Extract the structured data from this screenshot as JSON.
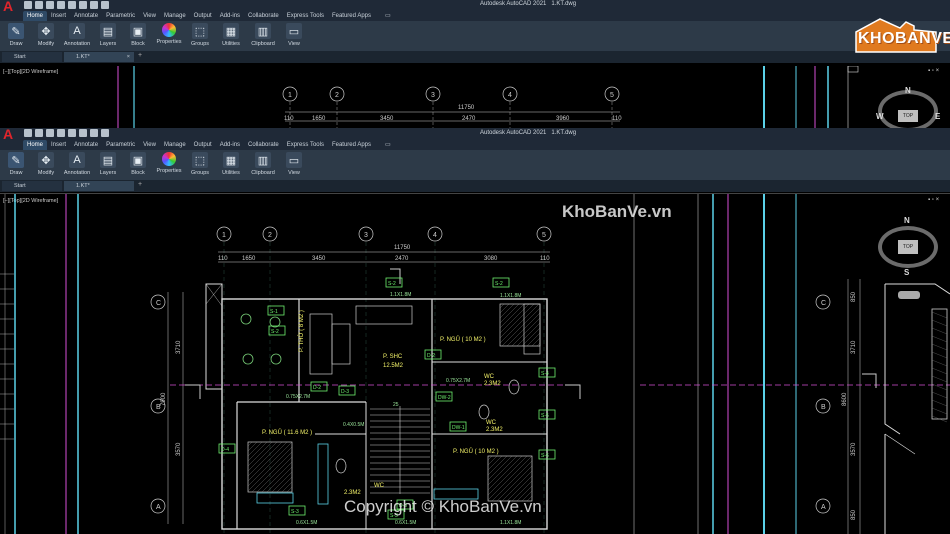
{
  "app": {
    "title": "Autodesk AutoCAD 2021",
    "file": "1.KT.dwg",
    "menu_tabs": [
      "Home",
      "Insert",
      "Annotate",
      "Parametric",
      "View",
      "Manage",
      "Output",
      "Add-ins",
      "Collaborate",
      "Express Tools",
      "Featured Apps"
    ],
    "ribbon_panels": [
      {
        "label": "Draw",
        "icon": "pencil-icon"
      },
      {
        "label": "Modify",
        "icon": "move-icon"
      },
      {
        "label": "Annotation",
        "icon": "text-icon"
      },
      {
        "label": "Layers",
        "icon": "layers-icon"
      },
      {
        "label": "Block",
        "icon": "block-icon"
      },
      {
        "label": "Properties",
        "icon": "color-wheel-icon"
      },
      {
        "label": "Groups",
        "icon": "groups-icon"
      },
      {
        "label": "Utilities",
        "icon": "calculator-icon"
      },
      {
        "label": "Clipboard",
        "icon": "clipboard-icon"
      },
      {
        "label": "View",
        "icon": "view-icon"
      }
    ],
    "doc_tabs": {
      "start": "Start",
      "active": "1.KT*"
    },
    "view_label": "[−][Top][2D Wireframe]",
    "close": "×",
    "plus": "+"
  },
  "navcube": {
    "n": "N",
    "s": "S",
    "e": "E",
    "w": "W",
    "top": "TOP"
  },
  "watermarks": {
    "logo": "KHOBANVE",
    "site": "KhoBanVe.vn",
    "copyright": "Copyright © KhoBanVe.vn"
  },
  "drawing": {
    "grid_numbers": [
      "1",
      "2",
      "3",
      "4",
      "5"
    ],
    "grid_letters": [
      "C",
      "B",
      "A"
    ],
    "overall_dim": "11750",
    "dims": [
      "110",
      "1650",
      "3450",
      "2470",
      "3960",
      "110"
    ],
    "dims2": [
      "110",
      "1650",
      "3450",
      "2470",
      "3080",
      "110"
    ],
    "rooms": [
      {
        "name": "P. NGỦ ( 10 M2 )"
      },
      {
        "name": "P. SHC"
      },
      {
        "name": "12.5M2"
      },
      {
        "name": "P. THỜ ( 8 M2 )"
      },
      {
        "name": "P. NGỦ ( 11.6 M2 )"
      },
      {
        "name": "P. NGỦ ( 10 M2 )"
      },
      {
        "name": "WC"
      },
      {
        "name": "2.3M2"
      },
      {
        "name": "WC"
      },
      {
        "name": "2.3M2"
      },
      {
        "name": "WC"
      },
      {
        "name": "2.3M2"
      }
    ],
    "left_dims": [
      "3710",
      "7900",
      "3570"
    ],
    "right_dims": [
      "850",
      "3710",
      "8600",
      "3570",
      "850"
    ],
    "tags": [
      "S-2",
      "S-2",
      "S-1",
      "S-2",
      "S-3",
      "S-3",
      "D-2",
      "D-3",
      "D-2",
      "D-4",
      "D-3",
      "DW-1",
      "DW-2",
      "S-4",
      "S-5",
      "S-6"
    ],
    "small": [
      "0.75X2.7M",
      "1.1X1.8M",
      "0.6X1.5M",
      "0.4X0.5M",
      "25"
    ]
  }
}
